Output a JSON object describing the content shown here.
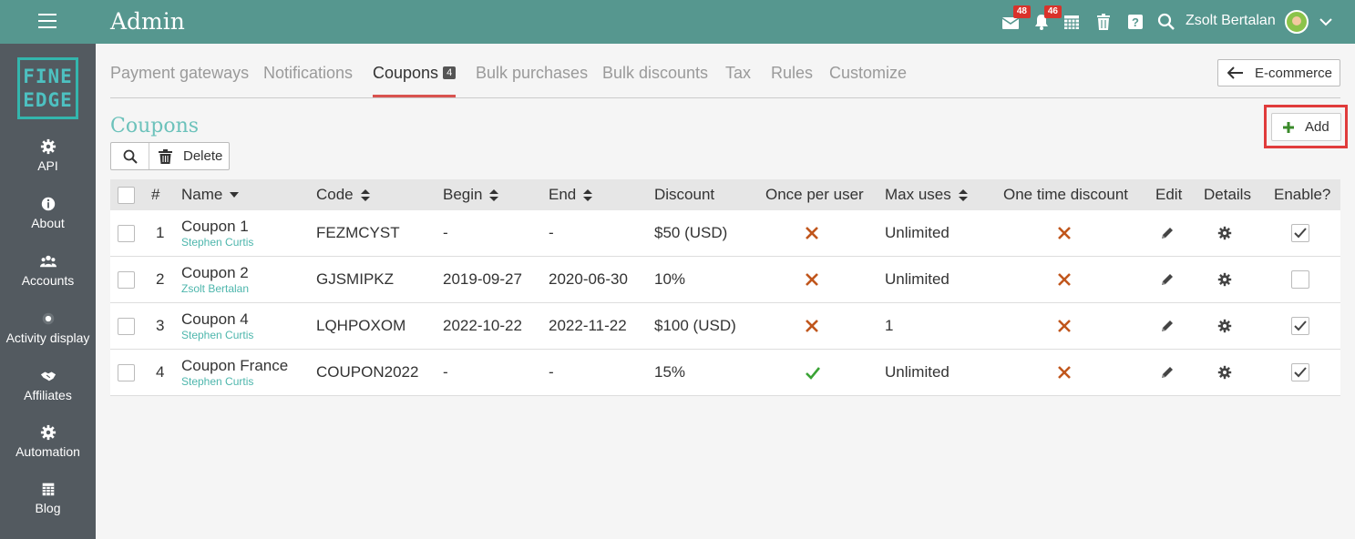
{
  "app": {
    "title": "Admin"
  },
  "topbar": {
    "mail_badge": "48",
    "notif_badge": "46",
    "username": "Zsolt Bertalan"
  },
  "sidebar": {
    "logo_line1": "FINE",
    "logo_line2": "EDGE",
    "items": [
      {
        "label": "API",
        "icon": "gear-icon"
      },
      {
        "label": "About",
        "icon": "info-icon"
      },
      {
        "label": "Accounts",
        "icon": "users-icon"
      },
      {
        "label": "Activity display",
        "icon": "dot-icon"
      },
      {
        "label": "Affiliates",
        "icon": "handshake-icon"
      },
      {
        "label": "Automation",
        "icon": "gear-icon"
      },
      {
        "label": "Blog",
        "icon": "calendar-icon"
      }
    ]
  },
  "tabs": [
    {
      "label": "Payment gateways"
    },
    {
      "label": "Notifications"
    },
    {
      "label": "Coupons",
      "count": "4",
      "active": true
    },
    {
      "label": "Bulk purchases"
    },
    {
      "label": "Bulk discounts"
    },
    {
      "label": "Tax"
    },
    {
      "label": "Rules"
    },
    {
      "label": "Customize"
    }
  ],
  "ecommerce_button": "E-commerce",
  "section_title": "Coupons",
  "add_button": "Add",
  "toolbar": {
    "delete_label": "Delete"
  },
  "table": {
    "headers": {
      "num": "#",
      "name": "Name",
      "code": "Code",
      "begin": "Begin",
      "end": "End",
      "discount": "Discount",
      "once_per_user": "Once per user",
      "max_uses": "Max uses",
      "one_time_discount": "One time discount",
      "edit": "Edit",
      "details": "Details",
      "enable": "Enable?"
    },
    "rows": [
      {
        "num": "1",
        "name": "Coupon 1",
        "owner": "Stephen Curtis",
        "code": "FEZMCYST",
        "begin": "-",
        "end": "-",
        "discount": "$50 (USD)",
        "once_per_user": false,
        "max_uses": "Unlimited",
        "one_time_discount": false,
        "enabled": true
      },
      {
        "num": "2",
        "name": "Coupon 2",
        "owner": "Zsolt Bertalan",
        "code": "GJSMIPKZ",
        "begin": "2019-09-27",
        "end": "2020-06-30",
        "discount": "10%",
        "once_per_user": false,
        "max_uses": "Unlimited",
        "one_time_discount": false,
        "enabled": false
      },
      {
        "num": "3",
        "name": "Coupon 4",
        "owner": "Stephen Curtis",
        "code": "LQHPOXOM",
        "begin": "2022-10-22",
        "end": "2022-11-22",
        "discount": "$100 (USD)",
        "once_per_user": false,
        "max_uses": "1",
        "one_time_discount": false,
        "enabled": true
      },
      {
        "num": "4",
        "name": "Coupon France",
        "owner": "Stephen Curtis",
        "code": "COUPON2022",
        "begin": "-",
        "end": "-",
        "discount": "15%",
        "once_per_user": true,
        "max_uses": "Unlimited",
        "one_time_discount": false,
        "enabled": true
      }
    ]
  },
  "colors": {
    "topbar": "#56978f",
    "sidebar": "#535a60",
    "accent": "#4db6ac",
    "cross": "#c0561c",
    "check": "#3aa335",
    "highlight": "#e03b3b"
  }
}
